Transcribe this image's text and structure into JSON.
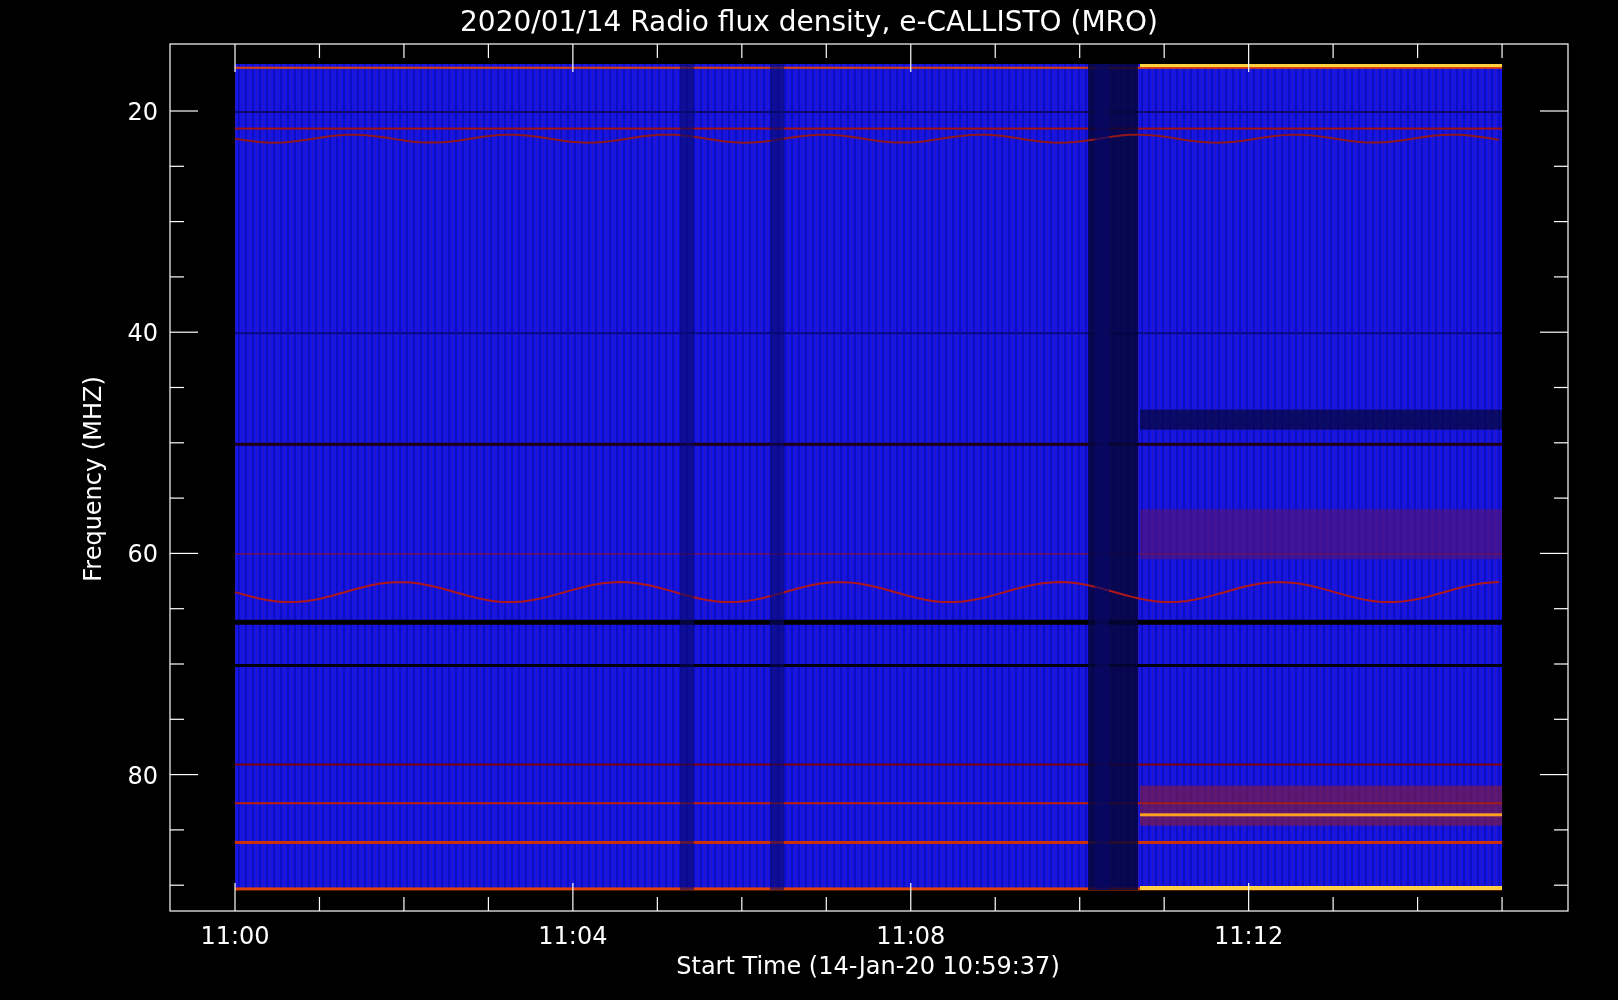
{
  "title": "2020/01/14  Radio flux density, e-CALLISTO (MRO)",
  "plot": {
    "ylabel": "Frequency (MHZ)",
    "xlabel": "Start Time (14-Jan-20 10:59:37)",
    "y_tick_labels": [
      "20",
      "40",
      "60",
      "80"
    ],
    "x_tick_labels": [
      "11:00",
      "11:04",
      "11:08",
      "11:12"
    ]
  }
}
